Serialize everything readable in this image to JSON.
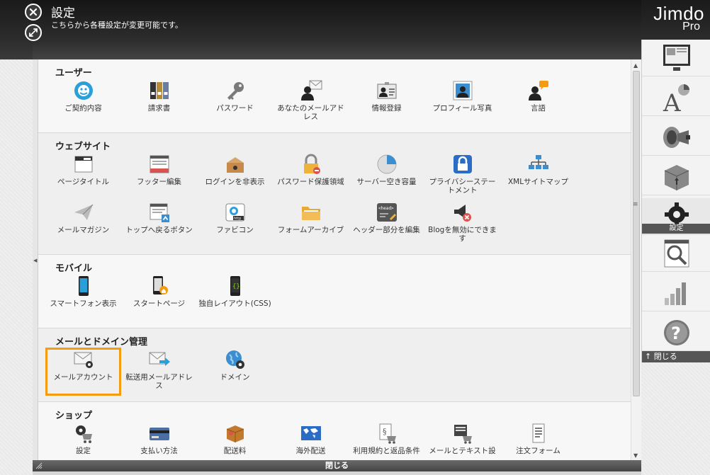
{
  "header": {
    "title": "設定",
    "subtitle": "こちらから各種設定が変更可能です。",
    "logo_main": "Jimdo",
    "logo_sub": "Pro"
  },
  "sections": [
    {
      "title": "ユーザー",
      "items": [
        {
          "label": "ご契約内容",
          "icon": "contract-icon"
        },
        {
          "label": "請求書",
          "icon": "invoice-binders-icon"
        },
        {
          "label": "パスワード",
          "icon": "key-icon"
        },
        {
          "label": "あなたのメールアドレス",
          "icon": "user-mail-icon"
        },
        {
          "label": "情報登録",
          "icon": "id-card-icon"
        },
        {
          "label": "プロフィール写真",
          "icon": "profile-photo-icon"
        },
        {
          "label": "言語",
          "icon": "language-icon"
        }
      ]
    },
    {
      "title": "ウェブサイト",
      "items": [
        {
          "label": "ページタイトル",
          "icon": "page-title-icon"
        },
        {
          "label": "フッター編集",
          "icon": "footer-edit-icon"
        },
        {
          "label": "ログインを非表示",
          "icon": "login-hide-icon"
        },
        {
          "label": "パスワード保護領域",
          "icon": "lock-icon"
        },
        {
          "label": "サーバー空き容量",
          "icon": "pie-chart-icon"
        },
        {
          "label": "プライバシーステートメント",
          "icon": "privacy-lock-icon"
        },
        {
          "label": "XMLサイトマップ",
          "icon": "sitemap-icon"
        },
        {
          "label": "メールマガジン",
          "icon": "paper-plane-icon"
        },
        {
          "label": "トップへ戻るボタン",
          "icon": "back-to-top-icon"
        },
        {
          "label": "ファビコン",
          "icon": "favicon-icon"
        },
        {
          "label": "フォームアーカイブ",
          "icon": "folder-icon"
        },
        {
          "label": "ヘッダー部分を編集",
          "icon": "head-code-icon"
        },
        {
          "label": "Blogを無効にできます",
          "icon": "blog-disable-icon"
        }
      ]
    },
    {
      "title": "モバイル",
      "items": [
        {
          "label": "スマートフォン表示",
          "icon": "smartphone-icon"
        },
        {
          "label": "スタートページ",
          "icon": "start-page-icon"
        },
        {
          "label": "独自レイアウト(CSS)",
          "icon": "css-layout-icon"
        }
      ]
    },
    {
      "title": "メールとドメイン管理",
      "items": [
        {
          "label": "メールアカウント",
          "icon": "mail-gear-icon",
          "selected": true
        },
        {
          "label": "転送用メールアドレス",
          "icon": "mail-forward-icon"
        },
        {
          "label": "ドメイン",
          "icon": "globe-gear-icon"
        }
      ]
    },
    {
      "title": "ショップ",
      "items": [
        {
          "label": "設定",
          "icon": "cart-gear-icon"
        },
        {
          "label": "支払い方法",
          "icon": "credit-card-icon"
        },
        {
          "label": "配送料",
          "icon": "package-icon"
        },
        {
          "label": "海外配送",
          "icon": "world-map-icon"
        },
        {
          "label": "利用規約と返品条件",
          "icon": "terms-cart-icon"
        },
        {
          "label": "メールとテキスト設",
          "icon": "register-cart-icon"
        },
        {
          "label": "注文フォーム",
          "icon": "order-form-icon"
        }
      ]
    }
  ],
  "bottom_bar": {
    "label": "閉じる"
  },
  "sidebar": {
    "active_label": "設定",
    "close_label": "閉じる",
    "items": [
      {
        "name": "layout",
        "icon": "layout-monitor-icon"
      },
      {
        "name": "style",
        "icon": "style-letter-icon"
      },
      {
        "name": "marketing",
        "icon": "megaphone-icon"
      },
      {
        "name": "apps",
        "icon": "box-icon"
      },
      {
        "name": "settings",
        "icon": "gear-icon",
        "active": true
      },
      {
        "name": "seo",
        "icon": "magnifier-icon"
      },
      {
        "name": "stats",
        "icon": "bar-stats-icon"
      },
      {
        "name": "help",
        "icon": "help-icon"
      }
    ]
  },
  "colors": {
    "selected_outline": "#f39c12",
    "header_bg": "#1f1f1f",
    "panel_bg": "#f7f7f7",
    "sidebar_bar": "#555555"
  }
}
